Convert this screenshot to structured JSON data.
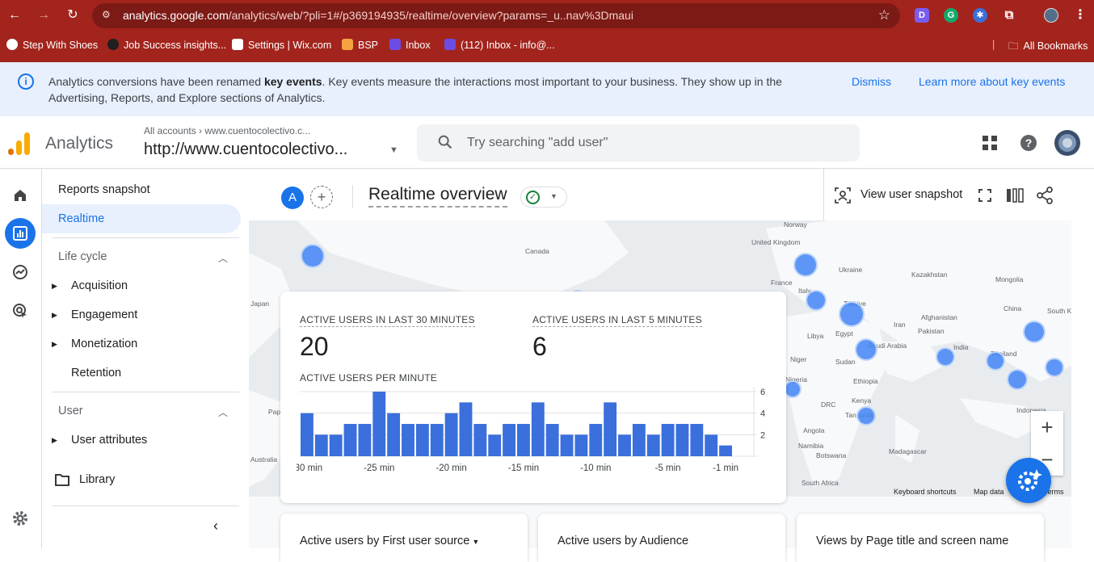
{
  "browser": {
    "url_host": "analytics.google.com",
    "url_path": "/analytics/web/?pli=1#/p369194935/realtime/overview?params=_u..nav%3Dmaui",
    "extensions": [
      "D",
      "G"
    ],
    "bookmarks": [
      {
        "label": "Step With Shoes",
        "color": "#ffffff"
      },
      {
        "label": "Job Success insights...",
        "color": "#1f1f1f"
      },
      {
        "label": "Settings | Wix.com",
        "color": "#ffffff"
      },
      {
        "label": "BSP",
        "color": "#f4a340"
      },
      {
        "label": "Inbox",
        "color": "#6b4de6"
      },
      {
        "label": "(112) Inbox - info@...",
        "color": "#6b4de6"
      }
    ],
    "all_bookmarks": "All Bookmarks"
  },
  "banner": {
    "text_before": "Analytics conversions have been renamed ",
    "text_bold": "key events",
    "text_after": ". Key events measure the interactions most important to your business. They show up in the Advertising, Reports, and Explore sections of Analytics.",
    "dismiss": "Dismiss",
    "learn_more": "Learn more about key events"
  },
  "header": {
    "brand": "Analytics",
    "breadcrumb_all": "All accounts",
    "breadcrumb_account": "www.cuentocolectivo.c...",
    "property": "http://www.cuentocolectivo...",
    "search_placeholder": "Try searching \"add user\""
  },
  "nav": {
    "reports_snapshot": "Reports snapshot",
    "realtime": "Realtime",
    "life_cycle": "Life cycle",
    "acquisition": "Acquisition",
    "engagement": "Engagement",
    "monetization": "Monetization",
    "retention": "Retention",
    "user": "User",
    "user_attributes": "User attributes",
    "library": "Library"
  },
  "toolbar": {
    "comparison_avatar": "A",
    "title": "Realtime overview",
    "view_user_snapshot": "View user snapshot"
  },
  "map": {
    "labels": [
      {
        "text": "Norway"
      },
      {
        "text": "United Kingdom"
      },
      {
        "text": "Canada"
      },
      {
        "text": "Ukraine"
      },
      {
        "text": "France"
      },
      {
        "text": "Kazakhstan"
      },
      {
        "text": "Mongolia"
      },
      {
        "text": "Italy"
      },
      {
        "text": "Türkiye"
      },
      {
        "text": "Japan"
      },
      {
        "text": "Afghanistan"
      },
      {
        "text": "China"
      },
      {
        "text": "South K"
      },
      {
        "text": "Iran"
      },
      {
        "text": "Pakistan"
      },
      {
        "text": "Libya"
      },
      {
        "text": "Egypt"
      },
      {
        "text": "Saudi Arabia"
      },
      {
        "text": "India"
      },
      {
        "text": "Thailand"
      },
      {
        "text": "Niger"
      },
      {
        "text": "Sudan"
      },
      {
        "text": "Nigeria"
      },
      {
        "text": "Ethiopia"
      },
      {
        "text": "DRC"
      },
      {
        "text": "Kenya"
      },
      {
        "text": "Tanzania"
      },
      {
        "text": "Indonesia"
      },
      {
        "text": "Angola"
      },
      {
        "text": "Namibia"
      },
      {
        "text": "Madagascar"
      },
      {
        "text": "Botswana"
      },
      {
        "text": "Australia"
      },
      {
        "text": "Pap"
      },
      {
        "text": "South Africa"
      }
    ],
    "footer_shortcuts": "Keyboard shortcuts",
    "footer_mapdata": "Map data",
    "footer_terms": "Terms"
  },
  "card": {
    "active_30_label": "ACTIVE USERS IN LAST 30 MINUTES",
    "active_30_value": "20",
    "active_5_label": "ACTIVE USERS IN LAST 5 MINUTES",
    "active_5_value": "6",
    "per_minute_label": "ACTIVE USERS PER MINUTE"
  },
  "chart_data": {
    "type": "bar",
    "title": "ACTIVE USERS PER MINUTE",
    "categories": [
      "-30 min",
      "-29 min",
      "-28 min",
      "-27 min",
      "-26 min",
      "-25 min",
      "-24 min",
      "-23 min",
      "-22 min",
      "-21 min",
      "-20 min",
      "-19 min",
      "-18 min",
      "-17 min",
      "-16 min",
      "-15 min",
      "-14 min",
      "-13 min",
      "-12 min",
      "-11 min",
      "-10 min",
      "-9 min",
      "-8 min",
      "-7 min",
      "-6 min",
      "-5 min",
      "-4 min",
      "-3 min",
      "-2 min",
      "-1 min"
    ],
    "tick_labels": [
      "-30 min",
      "-25 min",
      "-20 min",
      "-15 min",
      "-10 min",
      "-5 min",
      "-1 min"
    ],
    "values": [
      4,
      2,
      2,
      3,
      3,
      6,
      4,
      3,
      3,
      3,
      4,
      5,
      3,
      2,
      3,
      3,
      5,
      3,
      2,
      2,
      3,
      5,
      2,
      3,
      2,
      3,
      3,
      3,
      2,
      1
    ],
    "yticks": [
      2,
      4,
      6
    ],
    "ylim": [
      0,
      6
    ],
    "color": "#3a6fdc"
  },
  "bottom_cards": [
    {
      "title": "Active users by First user source"
    },
    {
      "title": "Active users by Audience"
    },
    {
      "title": "Views by Page title and screen name"
    }
  ]
}
